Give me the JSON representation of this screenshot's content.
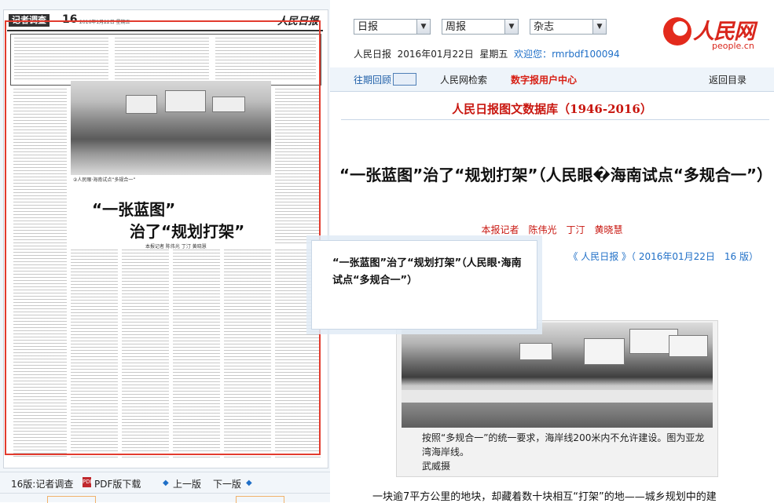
{
  "newspaper_page": {
    "section": "记者调查",
    "page_number": "16",
    "date_small": "2016年1月22日 星期五",
    "logo": "人民日报",
    "headline_line1": "“一张蓝图”",
    "headline_line2": "治了“规划打架”",
    "kicker": "②人民眼·海南试点“多规合一”",
    "byline": "本报记者  陈伟光  丁汀  黄晓慧"
  },
  "bottom_bar": {
    "page_label": "16版:记者调查",
    "pdf_download": "PDF版下载",
    "prev_page": "上一版",
    "next_page": "下一版"
  },
  "selects": [
    {
      "label": "日报"
    },
    {
      "label": "周报"
    },
    {
      "label": "杂志"
    }
  ],
  "info": {
    "paper": "人民日报",
    "date": "2016年01月22日",
    "weekday": "星期五",
    "welcome": "欢迎您：",
    "user": "rmrbdf100094"
  },
  "brand": {
    "cn": "人民网",
    "en": "people.cn"
  },
  "nav": {
    "back_issues": "往期回顾",
    "search": "人民网检索",
    "user_center": "数字报用户中心",
    "return": "返回目录"
  },
  "database_title": "人民日报图文数据库（1946-2016）",
  "article": {
    "title": "“一张蓝图”治了“规划打架”（人民眼�海南试点“多规合一”）",
    "authors": "本报记者　陈伟光　丁汀　黄晓慧",
    "source": "《 人民日报 》（ 2016年01月22日　16 版）",
    "caption": "按照“多规合一”的统一要求，海岸线200米内不允许建设。图为亚龙湾海岸线。",
    "photographer": "武威摄",
    "body_start": "一块逾7平方公里的地块，却藏着数十块相互“打架”的地——城乡规划中的建"
  },
  "tooltip": {
    "text": "“一张蓝图”治了“规划打架”（人民眼·海南试点“多规合一”）"
  },
  "colors": {
    "accent_red": "#c8160f",
    "link_blue": "#1f6fc7",
    "selection_red": "#e23b2e"
  }
}
